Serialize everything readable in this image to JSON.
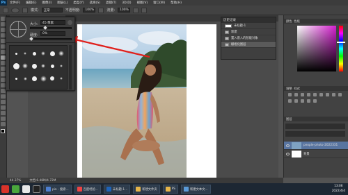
{
  "app": {
    "logo": "Ps"
  },
  "menu": [
    "文件(F)",
    "编辑(E)",
    "图像(I)",
    "图层(L)",
    "类型(Y)",
    "选择(S)",
    "滤镜(T)",
    "3D(D)",
    "视图(V)",
    "窗口(W)",
    "帮助(H)"
  ],
  "options": {
    "mode_label": "模式:",
    "mode_value": "正常",
    "opacity_label": "不透明度:",
    "opacity_value": "100%",
    "flow_label": "流量:",
    "flow_value": "100%"
  },
  "brush_panel": {
    "size_label": "大小:",
    "size_value": "45 像素",
    "hardness_label": "硬度:",
    "hardness_value": "0%",
    "hardness_fraction": 0.0
  },
  "history": {
    "title": "历史记录",
    "doc_name": "未标题-1",
    "rows": [
      "新建",
      "置入嵌入的智能对象",
      "栅格化图层"
    ]
  },
  "dock": {
    "color_tab": "颜色",
    "swatches_tab": "色板",
    "adjust_tab": "调整",
    "styles_tab": "样式",
    "layers_tab": "图层",
    "layers": [
      {
        "name": "people-photo-2022331"
      },
      {
        "name": "背景"
      }
    ]
  },
  "status": {
    "zoom": "44.37%",
    "doc_info": "文档:6.48M/4.72M"
  },
  "taskbar": {
    "buttons": [
      "pin - 搜索...",
      "百度经验...",
      "未标题-1...",
      "新建文件夹",
      "PS",
      "新建文本文..."
    ],
    "time": "13:06",
    "date": "2022/4/4"
  },
  "colors": {
    "accent_arrow": "#e0201c",
    "layer_selected": "#5874a0"
  }
}
